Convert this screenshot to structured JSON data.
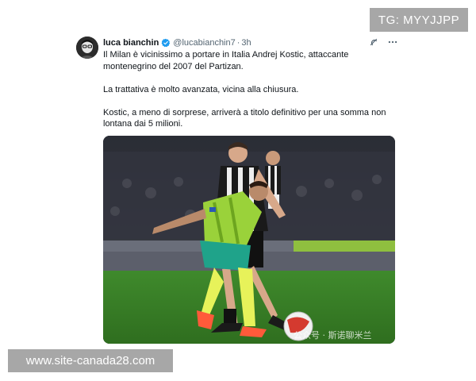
{
  "overlay": {
    "tg_label": "TG: MYYJJPP",
    "site_label": "www.site-canada28.com"
  },
  "tweet": {
    "display_name": "luca bianchin",
    "handle": "@lucabianchin7",
    "separator": "·",
    "time": "3h",
    "paragraphs": [
      "Il Milan è vicinissimo a portare in Italia Andrej Kostic, attaccante montenegrino del 2007 del Partizan.",
      "La trattativa è molto avanzata, vicina alla chiusura.",
      "Kostic, a meno di sorprese, arriverà a titolo definitivo per una somma non lontana dai 5 milioni."
    ],
    "icons": {
      "avatar": "avatar",
      "verified": "verified-badge-icon",
      "grok": "grok-icon",
      "more": "more-icon"
    },
    "media_watermark": "公众号 · 斯诺聊米兰",
    "colors": {
      "verified": "#1d9bf0",
      "secondary_text": "#536471",
      "primary_text": "#0f1419"
    }
  }
}
